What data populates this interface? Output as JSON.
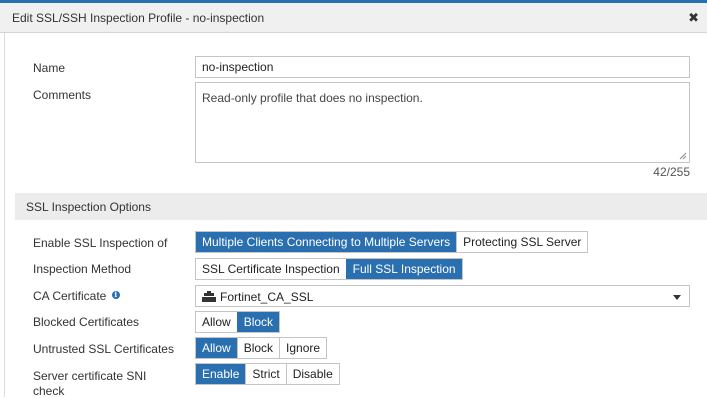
{
  "dialog": {
    "title": "Edit SSL/SSH Inspection Profile - no-inspection",
    "close_icon": "close-icon"
  },
  "form": {
    "name_label": "Name",
    "name_value": "no-inspection",
    "comments_label": "Comments",
    "comments_value": "Read-only profile that does no inspection.",
    "counter": "42/255"
  },
  "section": {
    "title": "SSL Inspection Options"
  },
  "options": {
    "enable_ssl": {
      "label": "Enable SSL Inspection of",
      "choices": [
        "Multiple Clients Connecting to Multiple Servers",
        "Protecting SSL Server"
      ],
      "selected": "Multiple Clients Connecting to Multiple Servers"
    },
    "inspection_method": {
      "label": "Inspection Method",
      "choices": [
        "SSL Certificate Inspection",
        "Full SSL Inspection"
      ],
      "selected": "Full SSL Inspection"
    },
    "ca_certificate": {
      "label": "CA Certificate",
      "info_icon": "info-icon",
      "value": "Fortinet_CA_SSL",
      "value_icon": "certificate-icon"
    },
    "blocked_certs": {
      "label": "Blocked Certificates",
      "choices": [
        "Allow",
        "Block"
      ],
      "selected": "Block"
    },
    "untrusted_certs": {
      "label": "Untrusted SSL Certificates",
      "choices": [
        "Allow",
        "Block",
        "Ignore"
      ],
      "selected": "Allow"
    },
    "sni_check": {
      "label_line1": "Server certificate SNI",
      "label_line2": "check",
      "choices": [
        "Enable",
        "Strict",
        "Disable"
      ],
      "selected": "Enable"
    }
  },
  "colors": {
    "accent": "#2a6fb0",
    "section_bg": "#ececec",
    "title_bg": "#f0f0f0"
  }
}
